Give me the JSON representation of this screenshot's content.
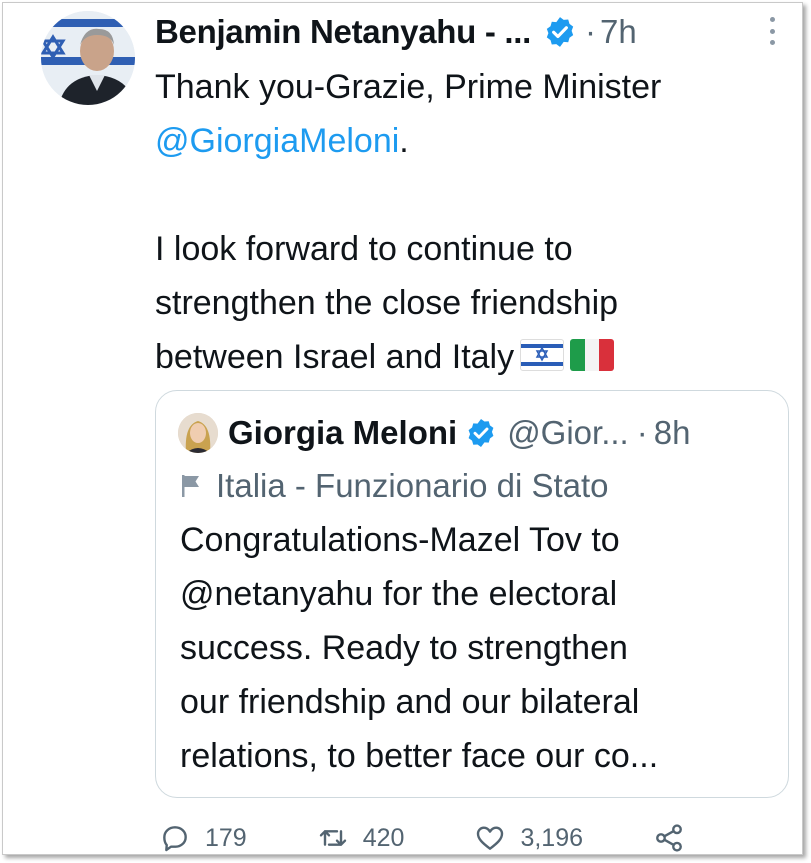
{
  "tweet": {
    "author_name": "Benjamin Netanyahu - ...",
    "separator": "·",
    "time": "7h",
    "text_lines": [
      "Thank you-Grazie, Prime Minister",
      "@GiorgiaMeloni",
      "",
      "I look forward to continue to",
      "strengthen the close friendship",
      "between Israel and Italy"
    ],
    "mention_suffix": ".",
    "flags": [
      "israel-flag",
      "italy-flag"
    ]
  },
  "quoted": {
    "author_name": "Giorgia Meloni",
    "handle": "@Gior...",
    "separator": "·",
    "time": "8h",
    "label": "Italia - Funzionario di Stato",
    "text_lines": [
      "Congratulations-Mazel Tov to",
      "@netanyahu for the electoral",
      "success. Ready to strengthen",
      "our friendship and our bilateral",
      "relations, to better face our co..."
    ]
  },
  "actions": {
    "replies": "179",
    "retweets": "420",
    "likes": "3,196"
  },
  "colors": {
    "accent": "#1d9bf0",
    "secondary_text": "#536471",
    "border": "#cfd9de"
  },
  "icons": [
    "verified-badge-icon",
    "more-icon",
    "flag-label-icon",
    "reply-icon",
    "retweet-icon",
    "like-icon",
    "share-icon"
  ]
}
